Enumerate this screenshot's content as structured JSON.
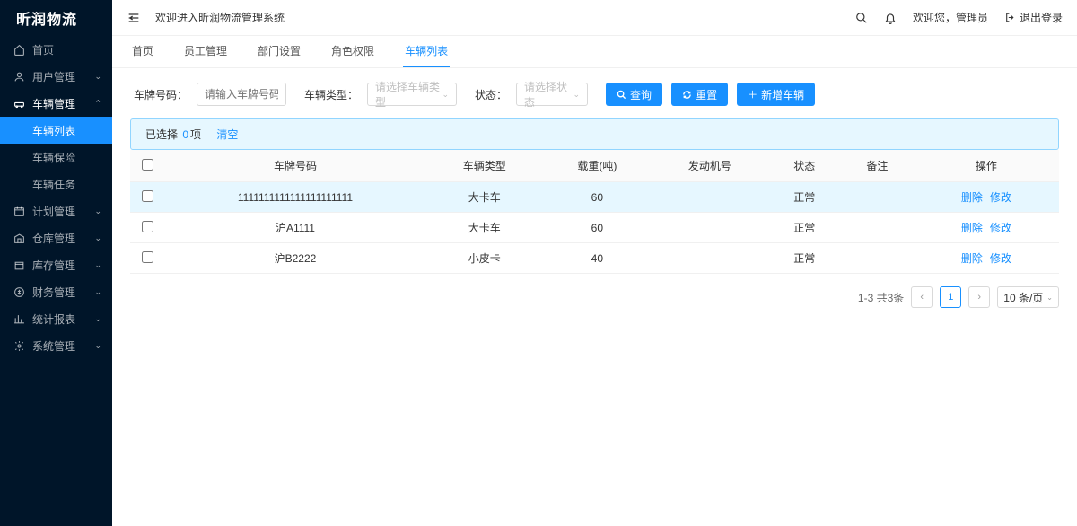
{
  "app_name": "昕润物流",
  "header": {
    "welcome": "欢迎进入昕润物流管理系统",
    "user_greeting": "欢迎您，管理员",
    "logout": "退出登录"
  },
  "sidebar": {
    "items": [
      {
        "label": "首页",
        "icon": "home"
      },
      {
        "label": "用户管理",
        "icon": "user",
        "arrow": "down"
      },
      {
        "label": "车辆管理",
        "icon": "car",
        "arrow": "up",
        "expanded": true
      },
      {
        "label": "计划管理",
        "icon": "plan",
        "arrow": "down"
      },
      {
        "label": "仓库管理",
        "icon": "warehouse",
        "arrow": "down"
      },
      {
        "label": "库存管理",
        "icon": "stock",
        "arrow": "down"
      },
      {
        "label": "财务管理",
        "icon": "finance",
        "arrow": "down"
      },
      {
        "label": "统计报表",
        "icon": "chart",
        "arrow": "down"
      },
      {
        "label": "系统管理",
        "icon": "settings",
        "arrow": "down"
      }
    ],
    "vehicle_sub": [
      {
        "label": "车辆列表",
        "active": true
      },
      {
        "label": "车辆保险"
      },
      {
        "label": "车辆任务"
      }
    ]
  },
  "tabs": [
    {
      "label": "首页"
    },
    {
      "label": "员工管理"
    },
    {
      "label": "部门设置"
    },
    {
      "label": "角色权限"
    },
    {
      "label": "车辆列表",
      "active": true
    }
  ],
  "search": {
    "plate_label": "车牌号码：",
    "plate_placeholder": "请输入车牌号码",
    "type_label": "车辆类型：",
    "type_placeholder": "请选择车辆类型",
    "status_label": "状态：",
    "status_placeholder": "请选择状态",
    "query_btn": "查询",
    "reset_btn": "重置",
    "add_btn": "新增车辆"
  },
  "selection_bar": {
    "prefix": "已选择",
    "count": "0",
    "suffix": "项",
    "clear": "清空"
  },
  "table": {
    "columns": [
      "车牌号码",
      "车辆类型",
      "载重(吨)",
      "发动机号",
      "状态",
      "备注",
      "操作"
    ],
    "rows": [
      {
        "plate": "1111111111111111111111",
        "type": "大卡车",
        "load": "60",
        "engine": "",
        "status": "正常",
        "remark": ""
      },
      {
        "plate": "沪A1111",
        "type": "大卡车",
        "load": "60",
        "engine": "",
        "status": "正常",
        "remark": ""
      },
      {
        "plate": "沪B2222",
        "type": "小皮卡",
        "load": "40",
        "engine": "",
        "status": "正常",
        "remark": ""
      }
    ],
    "op_delete": "删除",
    "op_edit": "修改"
  },
  "pagination": {
    "info": "1-3 共3条",
    "current": "1",
    "size": "10 条/页"
  }
}
